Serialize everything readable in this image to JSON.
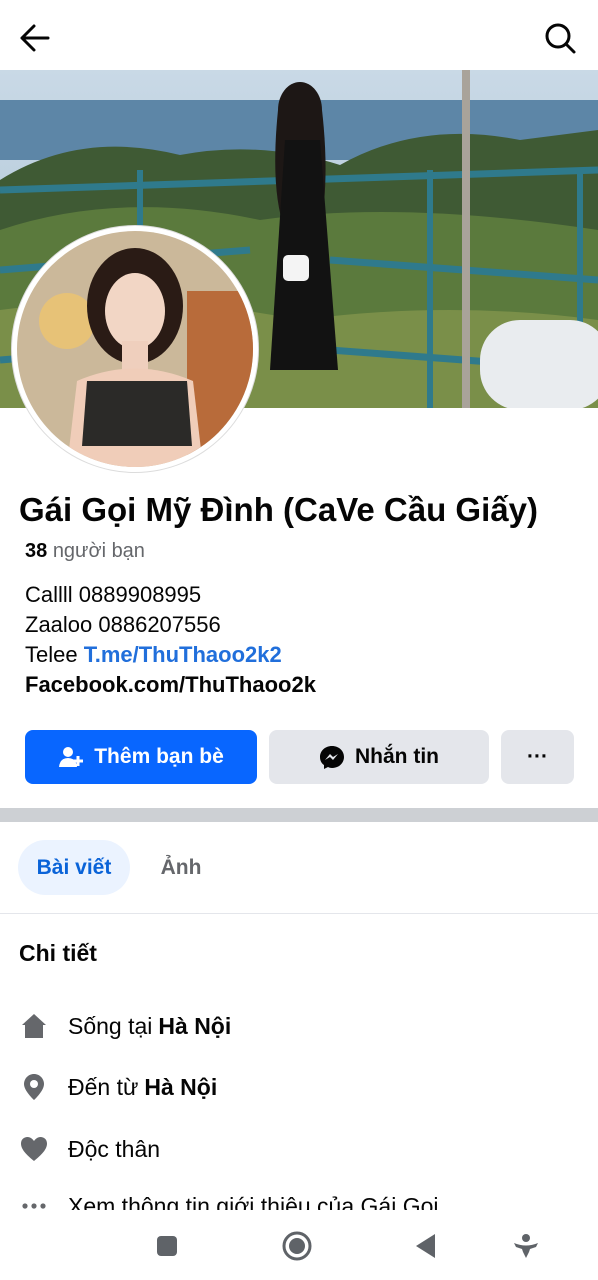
{
  "topbar": {
    "back_icon": "arrow-left-icon",
    "search_icon": "search-icon"
  },
  "profile": {
    "name": "Gái Gọi Mỹ Đình (CaVe Cầu Giấy)",
    "friends_count": "38",
    "friends_label": "người bạn",
    "bio": {
      "line1": "Callll 0889908995",
      "line2": "Zaaloo 0886207556",
      "line3_prefix": "Telee ",
      "line3_link": "T.me/ThuThaoo2k2",
      "line4": "Facebook.com/ThuThaoo2k"
    }
  },
  "actions": {
    "add_friend": "Thêm bạn bè",
    "message": "Nhắn tin",
    "more": "···"
  },
  "tabs": [
    {
      "label": "Bài viết",
      "active": true
    },
    {
      "label": "Ảnh",
      "active": false
    }
  ],
  "details": {
    "title": "Chi tiết",
    "items": [
      {
        "icon": "home-icon",
        "prefix": "Sống tại",
        "value": "Hà Nội"
      },
      {
        "icon": "location-pin-icon",
        "prefix": "Đến từ",
        "value": "Hà Nội"
      },
      {
        "icon": "heart-icon",
        "prefix": "Độc thân",
        "value": ""
      },
      {
        "icon": "more-dots-icon",
        "prefix": "Xem thông tin giới thiệu của Gái Gọi",
        "value": ""
      }
    ]
  },
  "colors": {
    "primary": "#0866ff",
    "link": "#216fdb",
    "secondary_bg": "#e4e6eb",
    "tab_active_bg": "#ebf3ff",
    "muted": "#65676b"
  },
  "navbar": {
    "icons": [
      "square-icon",
      "home-circle-icon",
      "back-triangle-icon",
      "accessibility-icon"
    ]
  }
}
